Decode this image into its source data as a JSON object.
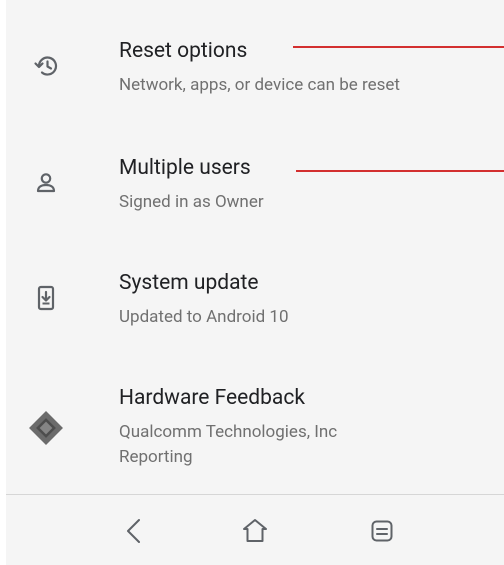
{
  "settings": {
    "items": [
      {
        "title": "Reset options",
        "subtitle": "Network, apps, or device can be reset",
        "icon": "history-icon"
      },
      {
        "title": "Multiple users",
        "subtitle": "Signed in as Owner",
        "icon": "person-icon"
      },
      {
        "title": "System update",
        "subtitle": "Updated to Android 10",
        "icon": "system-update-icon"
      },
      {
        "title": "Hardware Feedback",
        "subtitle_line1": "Qualcomm Technologies, Inc",
        "subtitle_line2": "Reporting",
        "icon": "chip-icon"
      }
    ]
  },
  "navbar": {
    "buttons": [
      {
        "name": "back",
        "icon": "back-icon"
      },
      {
        "name": "home",
        "icon": "home-icon"
      },
      {
        "name": "recents",
        "icon": "recents-icon"
      }
    ]
  },
  "annotations": {
    "color": "#d32f2f"
  },
  "colors": {
    "background": "#f5f5f5",
    "title": "#202124",
    "subtitle": "#707070",
    "icon": "#5f6368"
  }
}
